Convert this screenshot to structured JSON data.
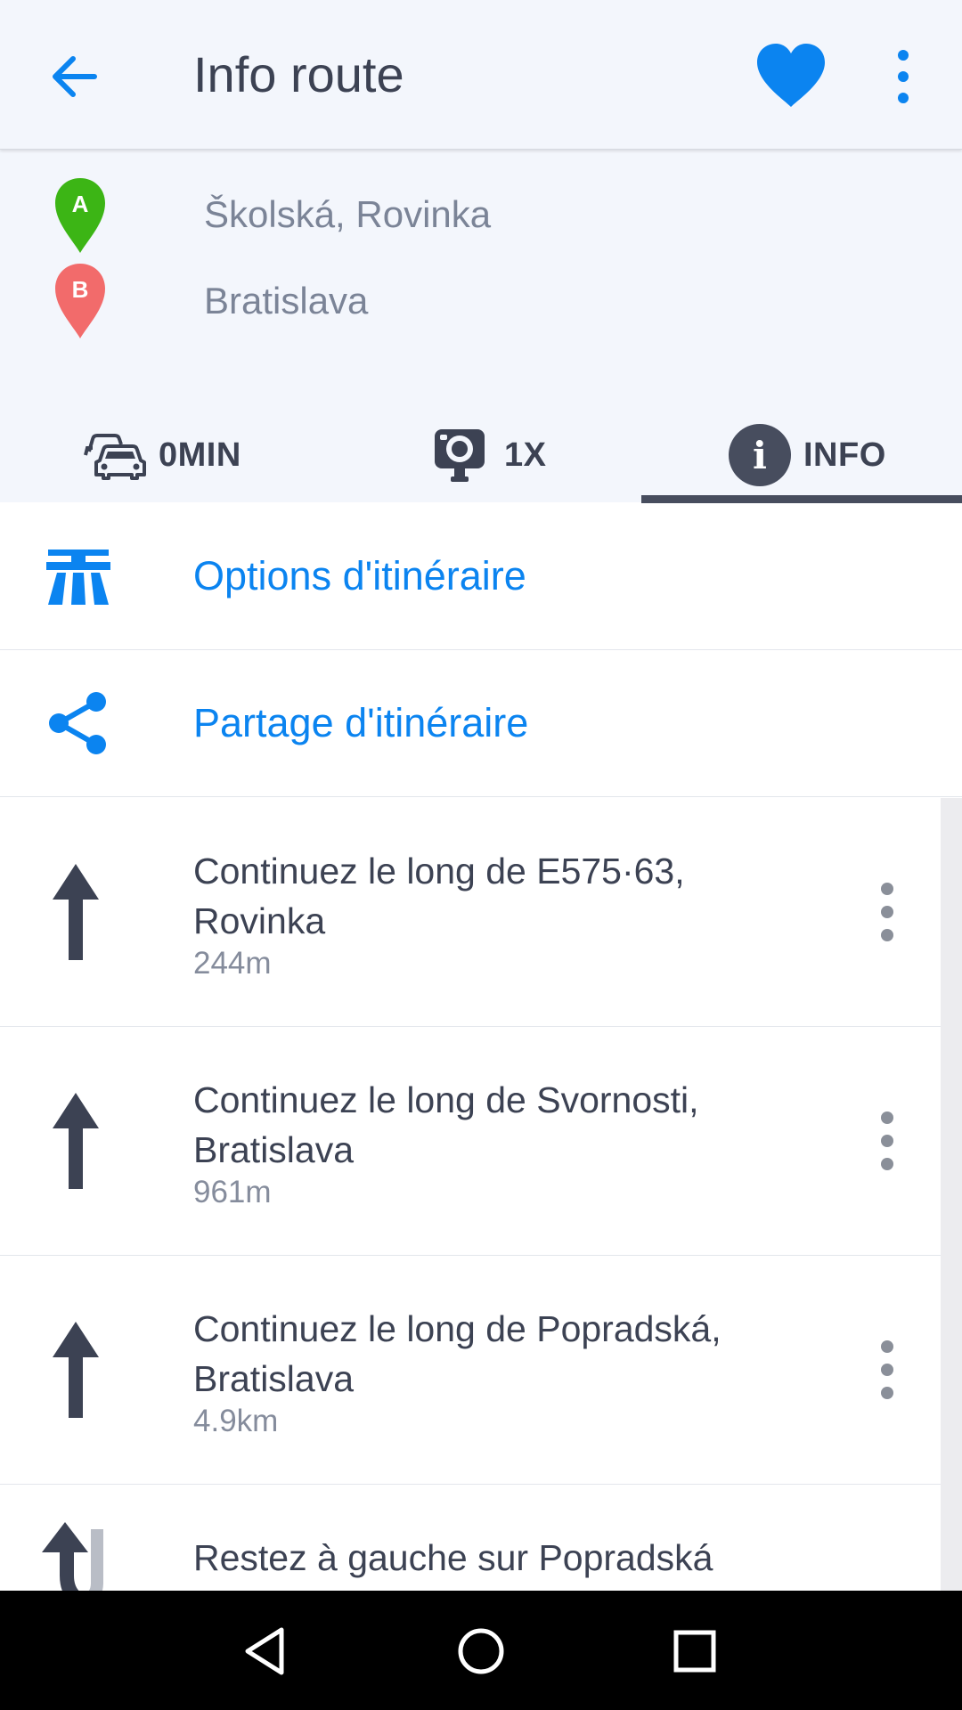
{
  "appbar": {
    "title": "Info route",
    "icons": {
      "back": "arrow-left-icon",
      "favorite": "heart-icon",
      "more": "more-vertical-icon"
    },
    "accent": "#0b84f0"
  },
  "route": {
    "origin": {
      "marker": "A",
      "name": "Školská, Rovinka",
      "color": "#3cb515"
    },
    "destination": {
      "marker": "B",
      "name": "Bratislava",
      "color": "#f26b6b"
    }
  },
  "tabs": [
    {
      "label": "0MIN",
      "icon": "traffic-cars-icon"
    },
    {
      "label": "1X",
      "icon": "speed-camera-icon"
    },
    {
      "label": "INFO",
      "icon": "info-icon",
      "selected": true
    }
  ],
  "options": [
    {
      "label": "Options d'itinéraire",
      "icon": "highway-icon"
    },
    {
      "label": "Partage d'itinéraire",
      "icon": "share-icon"
    }
  ],
  "steps": [
    {
      "instruction": "Continuez le long de E575·63, Rovinka",
      "distance": "244m",
      "icon": "arrow-straight-icon"
    },
    {
      "instruction": "Continuez le long de Svornosti, Bratislava",
      "distance": "961m",
      "icon": "arrow-straight-icon"
    },
    {
      "instruction": "Continuez le long de Popradská, Bratislava",
      "distance": "4.9km",
      "icon": "arrow-straight-icon"
    },
    {
      "instruction": "Restez à gauche sur Popradská",
      "distance": "",
      "icon": "keep-left-icon"
    }
  ],
  "navbar": {
    "icons": [
      "nav-back-icon",
      "nav-home-icon",
      "nav-recents-icon"
    ]
  }
}
